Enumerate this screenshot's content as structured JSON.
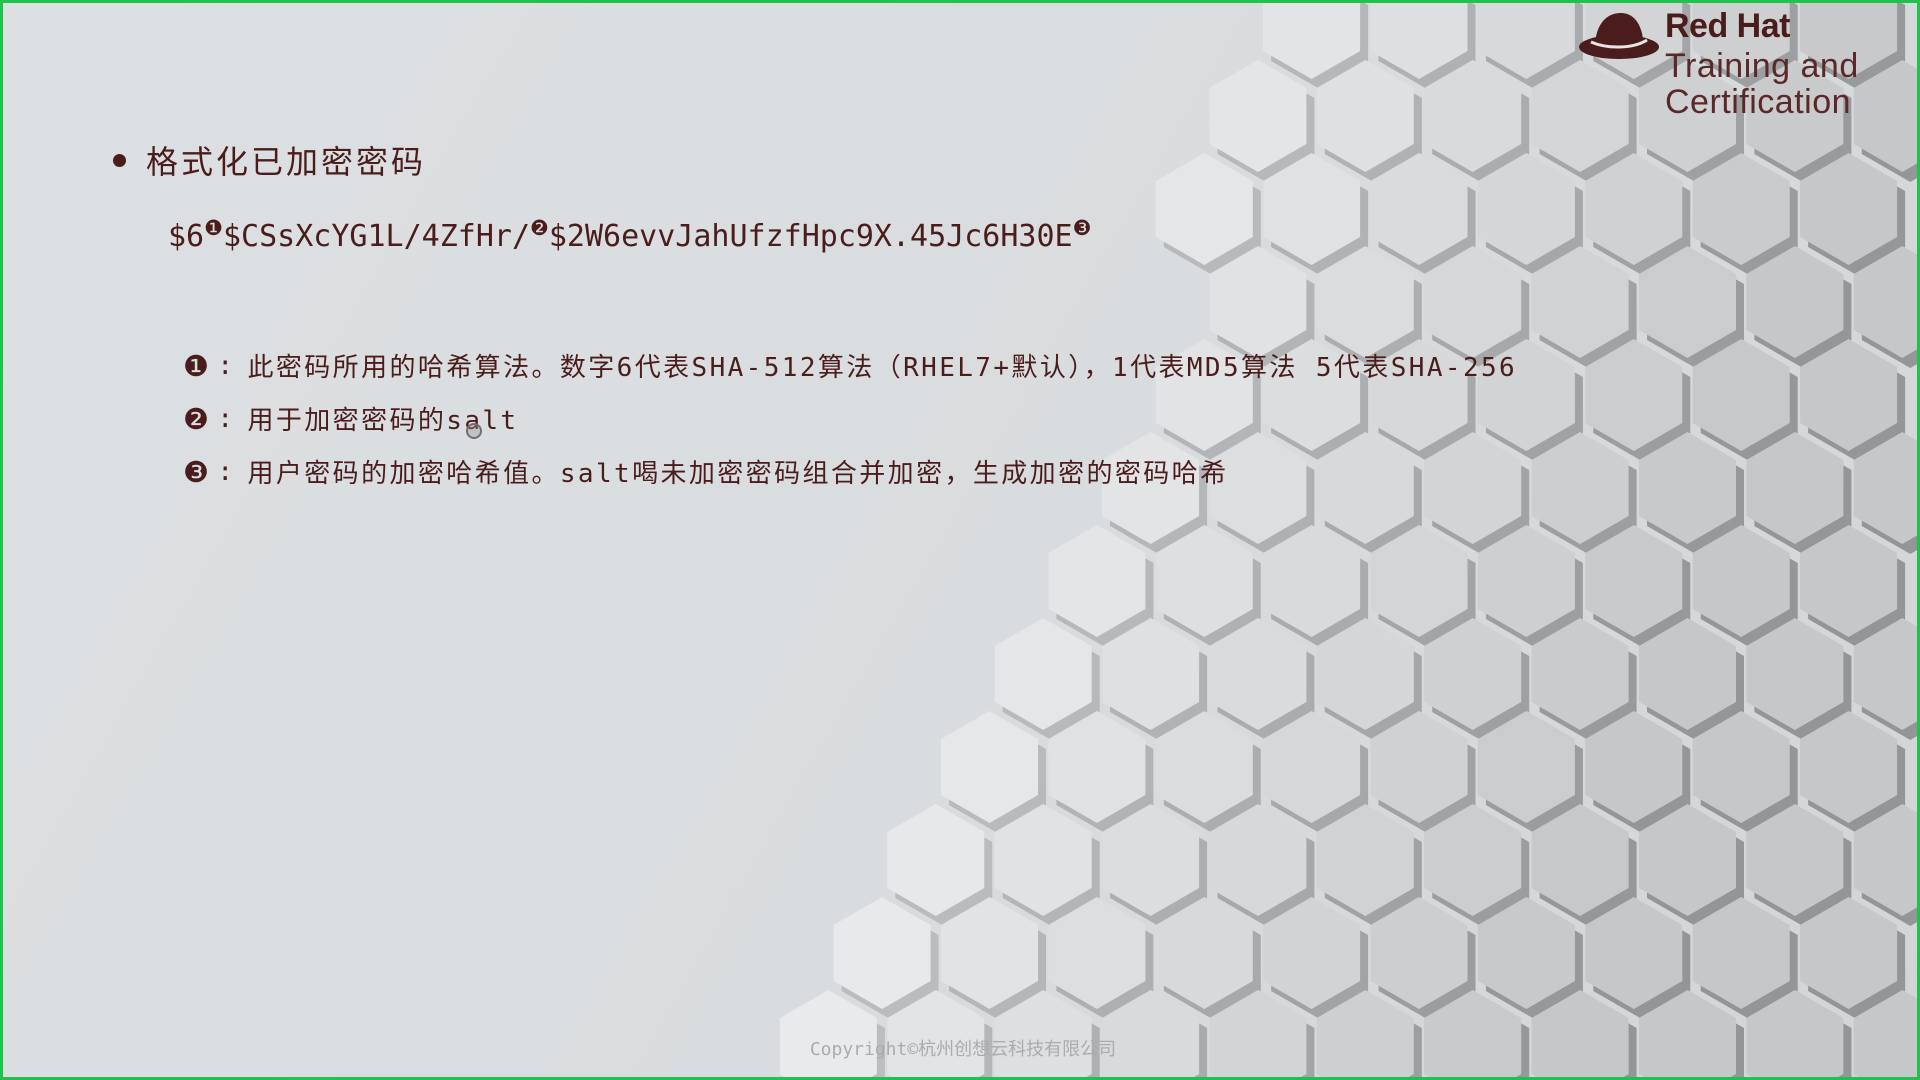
{
  "logo": {
    "brand": "Red Hat",
    "line1": "Training and",
    "line2": "Certification"
  },
  "bullet": {
    "title": "格式化已加密密码"
  },
  "hash": {
    "part1": "$6",
    "marker1": "❶",
    "part2": "$CSsXcYG1L/4ZfHr/",
    "marker2": "❷",
    "part3": "$2W6evvJahUfzfHpc9X.45Jc6H30E",
    "marker3": "❸"
  },
  "notes": [
    {
      "marker": "❶",
      "colon": ":",
      "text": "此密码所用的哈希算法。数字6代表SHA-512算法（RHEL7+默认），1代表MD5算法 5代表SHA-256"
    },
    {
      "marker": "❷",
      "colon": ":",
      "text": "用于加密密码的salt"
    },
    {
      "marker": "❸",
      "colon": ":",
      "text": "用户密码的加密哈希值。salt喝未加密密码组合并加密，生成加密的密码哈希"
    }
  ],
  "footer": {
    "copyright": "Copyright©杭州创想云科技有限公司"
  },
  "colors": {
    "text": "#4a1c1c",
    "border": "#1fc24a",
    "background": "#dde0e2",
    "hex_light": "#eef0f1",
    "hex_shadow": "#a7a9ab"
  }
}
